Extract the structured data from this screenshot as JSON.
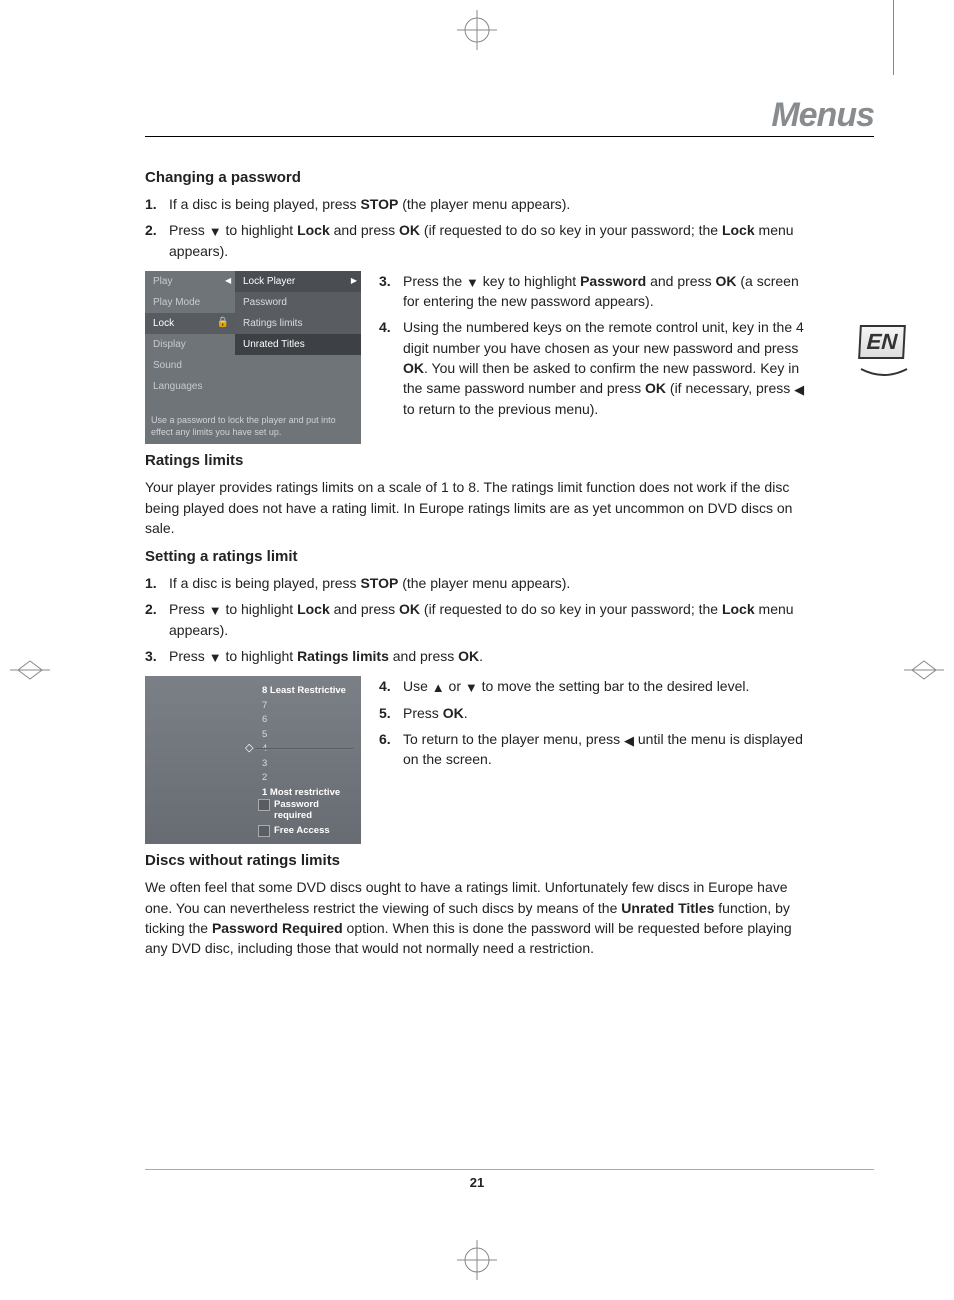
{
  "page": {
    "title": "Menus",
    "number": "21",
    "language_badge": "EN"
  },
  "section1": {
    "heading": "Changing a password",
    "step1": {
      "num": "1.",
      "pre": "If a disc is being played, press ",
      "stop": "STOP",
      "post": " (the player menu appears)."
    },
    "step2": {
      "num": "2.",
      "a": "Press ",
      "b": " to highlight ",
      "lock": "Lock",
      "c": " and press ",
      "ok": "OK",
      "d": " (if requested to do so key in your password; the ",
      "lock2": "Lock",
      "e": " menu appears)."
    },
    "step3": {
      "num": "3.",
      "a": "Press the ",
      "b": " key to highlight ",
      "pw": "Password",
      "c": " and press ",
      "ok": "OK",
      "d": " (a screen for entering the new password appears)."
    },
    "step4": {
      "num": "4.",
      "a": "Using the numbered keys on the remote control unit, key in the 4 digit number you have chosen as your new password and press ",
      "ok1": "OK",
      "b": ". You will then be asked to confirm the new password. Key in the same password number and press ",
      "ok2": "OK",
      "c": " (if necessary, press ",
      "d": " to return to the previous menu)."
    }
  },
  "screenshot1": {
    "left": [
      "Play",
      "Play Mode",
      "Lock",
      "Display",
      "Sound",
      "Languages"
    ],
    "right": [
      "Lock Player",
      "Password",
      "Ratings limits",
      "Unrated Titles"
    ],
    "hint": "Use a password to lock the player and put into effect any limits you have set up."
  },
  "section2": {
    "heading": "Ratings limits",
    "para": "Your player provides ratings limits on a scale of 1 to 8. The ratings limit function does not work if the disc being played does not have a rating limit. In Europe ratings limits are as yet uncommon on DVD discs on sale."
  },
  "section3": {
    "heading": "Setting a ratings limit",
    "step1": {
      "num": "1.",
      "pre": "If a disc is being played, press ",
      "stop": "STOP",
      "post": " (the player menu appears)."
    },
    "step2": {
      "num": "2.",
      "a": "Press ",
      "b": " to highlight ",
      "lock": "Lock",
      "c": " and press ",
      "ok": "OK",
      "d": " (if requested to do so key in your password; the ",
      "lock2": "Lock",
      "e": " menu appears)."
    },
    "step3": {
      "num": "3.",
      "a": "Press ",
      "b": " to highlight ",
      "rl": "Ratings limits",
      "c": " and press ",
      "ok": "OK",
      "d": "."
    },
    "step4": {
      "num": "4.",
      "a": "Use ",
      "b": " or ",
      "c": " to move the setting bar to the desired level."
    },
    "step5": {
      "num": "5.",
      "a": "Press ",
      "ok": "OK",
      "b": "."
    },
    "step6": {
      "num": "6.",
      "a": "To return to the player menu, press ",
      "b": " until the menu is displayed on the screen."
    }
  },
  "screenshot2": {
    "levels": [
      "8 Least Restrictive",
      "7",
      "6",
      "5",
      "4",
      "3",
      "2",
      "1 Most restrictive"
    ],
    "opts": [
      "Password required",
      "Free Access"
    ]
  },
  "section4": {
    "heading": "Discs without ratings limits",
    "a": "We often feel that some DVD discs ought to have a ratings limit. Unfortunately few discs in Europe have one. You can nevertheless restrict the viewing of such discs by means of the ",
    "ut": "Unrated Titles",
    "b": " function, by ticking the ",
    "pr": "Password Required",
    "c": " option. When this is done the password will be requested before playing any DVD disc, including those that would not normally need a restriction."
  }
}
